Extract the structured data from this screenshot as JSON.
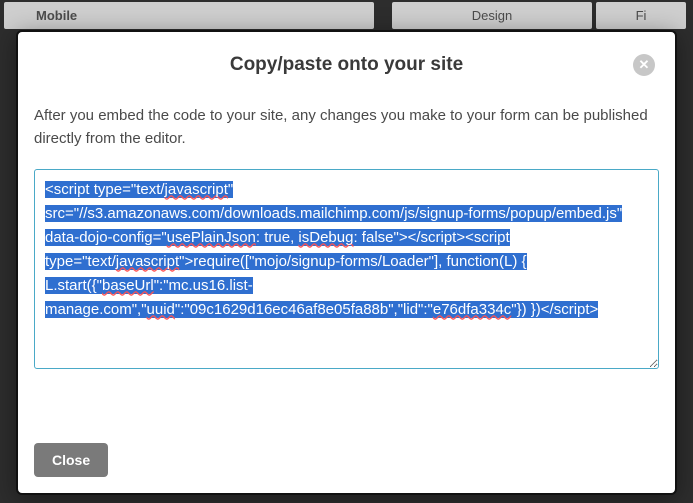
{
  "background": {
    "tabs": [
      "Mobile",
      "Design",
      "Fi"
    ]
  },
  "modal": {
    "title": "Copy/paste onto your site",
    "close_icon_glyph": "✕",
    "instructions": "After you embed the code to your site, any changes you make to your form can be published directly from the editor.",
    "code_parts": {
      "p1": "<script type=\"text/",
      "p2_err": "javascript",
      "p3": "\" src=\"//s3.amazonaws.com/downloads.mailchimp.com/js/signup-forms/popup/embed.js\" data-dojo-config=\"",
      "p4_err": "usePlainJson",
      "p5": ": true, ",
      "p6_err": "isDebug",
      "p7": ": false\"></script><script type=\"text/",
      "p8_err": "javascript",
      "p9": "\">require([\"mojo/signup-forms/Loader\"], function(L) { L.start({\"",
      "p10_err": "baseUrl",
      "p11": "\":\"mc.us16.list-manage.com\",\"",
      "p12_err": "uuid",
      "p13": "\":\"09c1629d16ec46af8e05fa88b\",\"lid\":\"",
      "p14_err": "e76dfa334c",
      "p15": "\"}) })</script>"
    },
    "footer": {
      "close_label": "Close"
    }
  }
}
